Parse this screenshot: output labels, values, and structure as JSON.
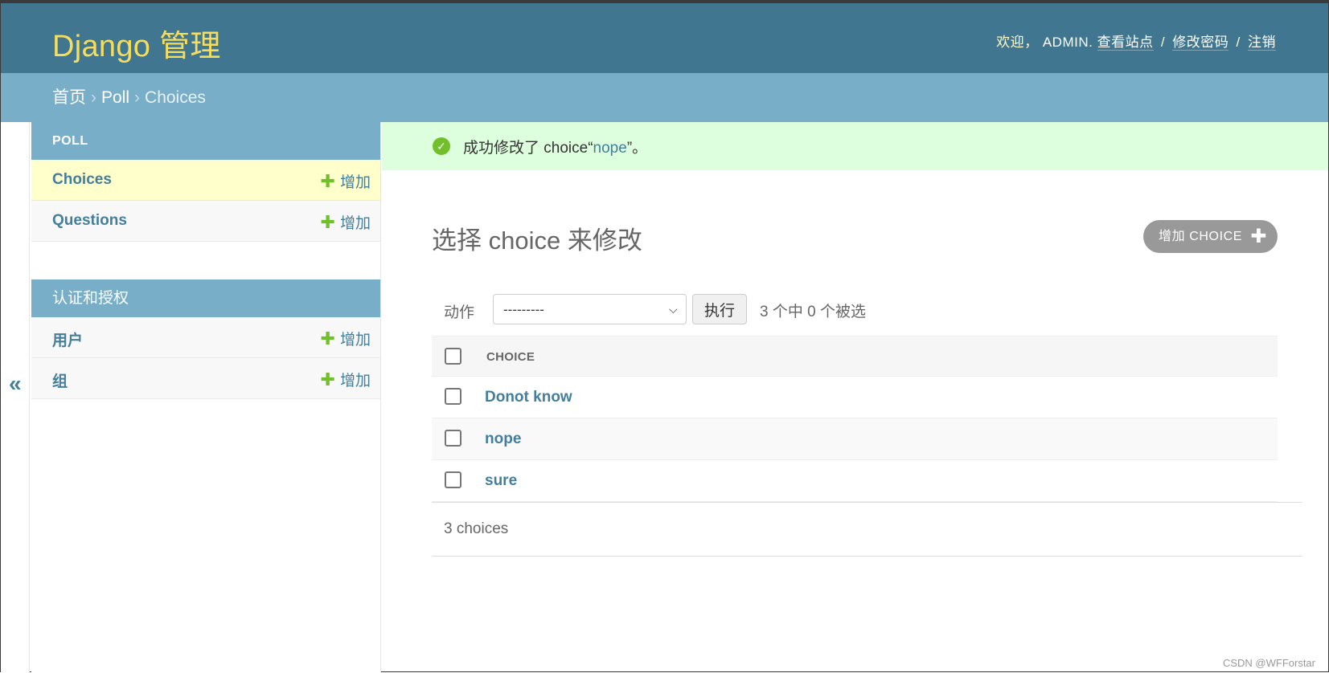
{
  "header": {
    "brand": "Django 管理",
    "welcome": "欢迎，",
    "username": "ADMIN",
    "view_site": "查看站点",
    "change_password": "修改密码",
    "logout": "注销",
    "dot": ".",
    "slash": "/"
  },
  "breadcrumbs": {
    "home": "首页",
    "app": "Poll",
    "current": "Choices",
    "arrow": "›"
  },
  "sidebar": {
    "toggle": "«",
    "modules": [
      {
        "caption": "POLL",
        "items": [
          {
            "label": "Choices",
            "add": "增加",
            "selected": true
          },
          {
            "label": "Questions",
            "add": "增加",
            "selected": false
          }
        ]
      },
      {
        "caption": "认证和授权",
        "items": [
          {
            "label": "用户",
            "add": "增加",
            "selected": false
          },
          {
            "label": "组",
            "add": "增加",
            "selected": false
          }
        ]
      }
    ]
  },
  "message": {
    "prefix": "成功修改了 choice“",
    "object": "nope",
    "suffix": "”。"
  },
  "content": {
    "title": "选择 choice 来修改",
    "add_button": "增加 CHOICE"
  },
  "actions": {
    "label": "动作",
    "selected_option": "---------",
    "go": "执行",
    "counter": "3 个中 0 个被选"
  },
  "table": {
    "column": "CHOICE",
    "rows": [
      "Donot know",
      "nope",
      "sure"
    ]
  },
  "paginator": "3 choices",
  "watermark": "CSDN @WFForstar",
  "colors": {
    "header_bg": "#417690",
    "brand": "#f5dd5d",
    "crumbs_bg": "#79aec8",
    "link": "#447e9b",
    "selected_row": "#ffffcc",
    "success_bg": "#dfd",
    "add_plus": "#70bf2b"
  }
}
